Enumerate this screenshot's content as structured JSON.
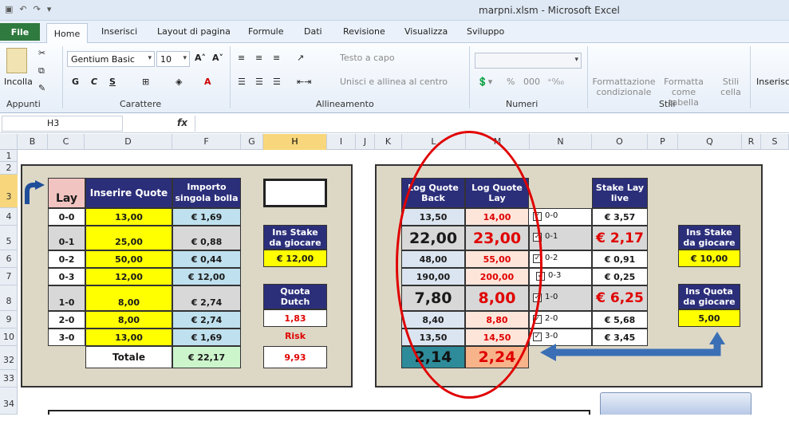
{
  "window": {
    "title": "marpni.xlsm - Microsoft Excel"
  },
  "ribbon": {
    "tabs": [
      "File",
      "Home",
      "Inserisci",
      "Layout di pagina",
      "Formule",
      "Dati",
      "Revisione",
      "Visualizza",
      "Sviluppo"
    ],
    "clipboard": {
      "paste": "Incolla",
      "group": "Appunti"
    },
    "font": {
      "name": "Gentium Basic",
      "size": "10",
      "bold": "G",
      "italic": "C",
      "underline": "S",
      "group": "Carattere"
    },
    "alignment": {
      "wrap": "Testo a capo",
      "merge": "Unisci e allinea al centro",
      "group": "Allineamento"
    },
    "number": {
      "format": "",
      "percent": "%",
      "thousands": "000",
      "group": "Numeri"
    },
    "styles": {
      "conditional": "Formattazione condizionale",
      "table": "Formatta come tabella",
      "cell": "Stili cella",
      "group": "Stili"
    },
    "cells": {
      "insert": "Inserisci"
    }
  },
  "formula_bar": {
    "name_box": "H3",
    "fx": "fx",
    "value": ""
  },
  "columns": [
    "B",
    "C",
    "D",
    "F",
    "G",
    "H",
    "I",
    "J",
    "K",
    "L",
    "M",
    "N",
    "O",
    "P",
    "Q",
    "R",
    "S"
  ],
  "rows": [
    "1",
    "2",
    "3",
    "4",
    "5",
    "6",
    "7",
    "8",
    "9",
    "10",
    "32",
    "33",
    "34"
  ],
  "left": {
    "lay": "Lay",
    "col_quote": "Inserire Quote",
    "col_importo_1": "Importo",
    "col_importo_2": "singola bolla",
    "rows": [
      {
        "label": "0-0",
        "quote": "13,00",
        "importo": "€ 1,69"
      },
      {
        "label": "0-1",
        "quote": "25,00",
        "importo": "€ 0,88"
      },
      {
        "label": "0-2",
        "quote": "50,00",
        "importo": "€ 0,44"
      },
      {
        "label": "0-3",
        "quote": "12,00",
        "importo": "€ 12,00"
      },
      {
        "label": "1-0",
        "quote": "8,00",
        "importo": "€ 2,74"
      },
      {
        "label": "2-0",
        "quote": "8,00",
        "importo": "€ 2,74"
      },
      {
        "label": "3-0",
        "quote": "13,00",
        "importo": "€ 1,69"
      }
    ],
    "totale": "Totale",
    "totale_value": "€ 22,17",
    "stake_1": "Ins Stake",
    "stake_2": "da giocare",
    "stake_value": "€ 12,00",
    "dutch_1": "Quota",
    "dutch_2": "Dutch",
    "dutch_value": "1,83",
    "risk": "Risk",
    "risk_value": "9,93"
  },
  "right": {
    "back_1": "Log Quote",
    "back_2": "Back",
    "lay_1": "Log Quote",
    "lay_2": "Lay",
    "stake_lay_1": "Stake Lay",
    "stake_lay_2": "live",
    "rows": [
      {
        "back": "13,50",
        "lay": "14,00",
        "check": "0-0",
        "stake": "€ 3,57"
      },
      {
        "back": "22,00",
        "lay": "23,00",
        "check": "0-1",
        "stake": "€ 2,17"
      },
      {
        "back": "48,00",
        "lay": "55,00",
        "check": "0-2",
        "stake": "€ 0,91"
      },
      {
        "back": "190,00",
        "lay": "200,00",
        "check": "0-3",
        "stake": "€ 0,25"
      },
      {
        "back": "7,80",
        "lay": "8,00",
        "check": "1-0",
        "stake": "€ 6,25"
      },
      {
        "back": "8,40",
        "lay": "8,80",
        "check": "2-0",
        "stake": "€ 5,68"
      },
      {
        "back": "13,50",
        "lay": "14,50",
        "check": "3-0",
        "stake": "€ 3,45"
      }
    ],
    "total_back": "2,14",
    "total_lay": "2,24",
    "stake_1": "Ins Stake",
    "stake_2": "da giocare",
    "stake_value": "€ 10,00",
    "quota_1": "Ins Quota",
    "quota_2": "da giocare",
    "quota_value": "5,00"
  },
  "colors": {
    "navy": "#2b2f7a",
    "yellow": "#ffff00",
    "red_ellipse": "#e00000",
    "panel": "#ddd8c6"
  }
}
